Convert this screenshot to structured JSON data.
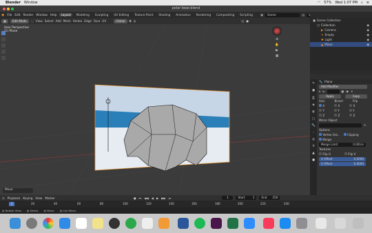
{
  "mac": {
    "app_name": "Blender",
    "menu": [
      "Window"
    ],
    "battery": "57%",
    "datetime": "Wed 1:07 PM"
  },
  "window": {
    "title": "polar bear.blend"
  },
  "topmenu": {
    "items": [
      "File",
      "Edit",
      "Render",
      "Window",
      "Help"
    ],
    "workspaces": [
      "Layout",
      "Modeling",
      "Sculpting",
      "UV Editing",
      "Texture Paint",
      "Shading",
      "Animation",
      "Rendering",
      "Compositing",
      "Scripting"
    ],
    "scene_label": "Scene",
    "viewlayer_label": "View Layer"
  },
  "viewheader": {
    "mode": "Edit Mode",
    "menus": [
      "View",
      "Select",
      "Add",
      "Mesh",
      "Vertex",
      "Edge",
      "Face",
      "UV"
    ],
    "transform": "Global"
  },
  "viewport": {
    "overlay_title": "User Perspective",
    "overlay_object": "(1) Plane",
    "last_op": "Move"
  },
  "outliner": {
    "root": "Scene Collection",
    "items": [
      {
        "label": "Collection"
      },
      {
        "label": "Camera"
      },
      {
        "label": "Empty"
      },
      {
        "label": "Light"
      },
      {
        "label": "Plane"
      }
    ]
  },
  "properties": {
    "object_name": "Plane",
    "add_modifier": "Add Modifier",
    "apply": "Apply",
    "copy": "Copy",
    "axis_label": "Axis",
    "bisect_label": "Bisect",
    "flip_label": "Flip",
    "axes": [
      "X",
      "Y",
      "Z"
    ],
    "mirror_object": "Mirror Object",
    "options": "Options",
    "vertex_groups": "Vertex Gro..",
    "clipping": "Clipping",
    "merge": "Merge",
    "merge_limit_label": "Merge Limit",
    "merge_limit": "0.001m",
    "textures": "Textures",
    "flip_u": "Flip U",
    "flip_v": "Flip V",
    "u_offset": "U Offset",
    "u_offset_val": "0.0000",
    "v_offset": "V Offset",
    "v_offset_val": "0.0000"
  },
  "timeline": {
    "menus": [
      "Playback",
      "Keying",
      "View",
      "Marker"
    ],
    "current": "1",
    "start_label": "Start",
    "start": "1",
    "end_label": "End",
    "end": "250",
    "ticks": [
      "1",
      "20",
      "40",
      "60",
      "80",
      "100",
      "120",
      "140",
      "160",
      "180",
      "200",
      "220",
      "240"
    ]
  },
  "statusbar": {
    "items": [
      "Rotate View",
      "Select",
      "Move",
      "Call Menu"
    ]
  },
  "colors": {
    "accent": "#4a77c4",
    "selection_orange": "#f29a35"
  }
}
